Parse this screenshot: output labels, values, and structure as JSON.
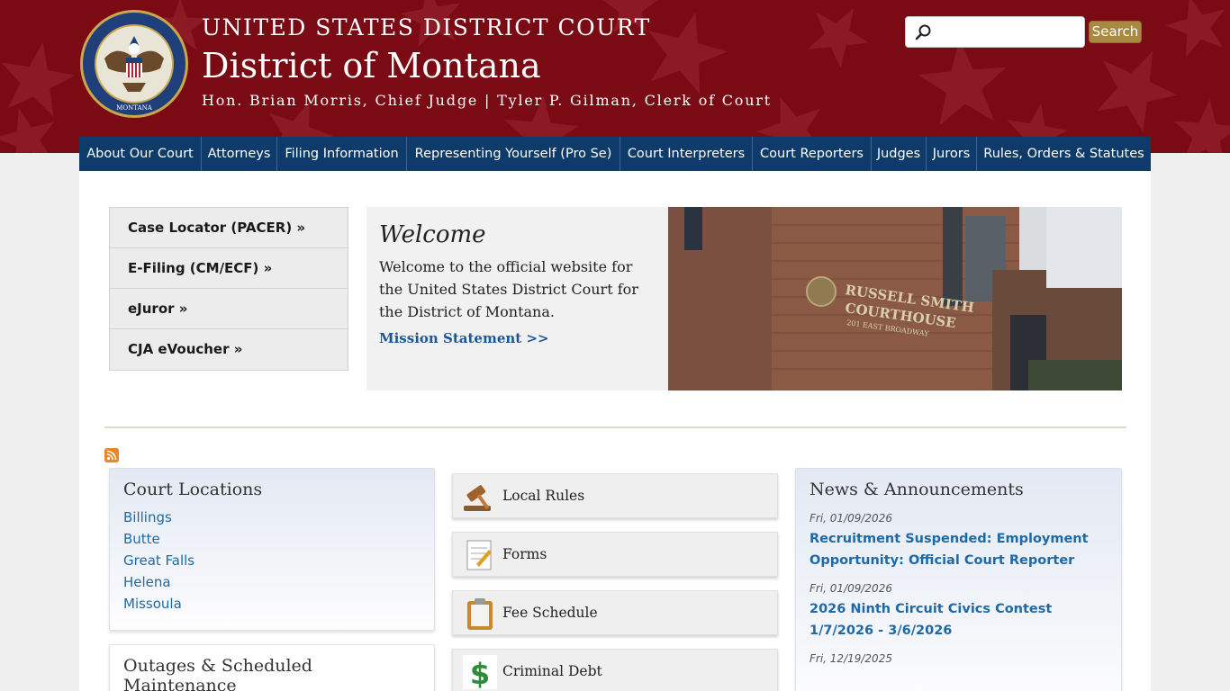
{
  "header": {
    "court_top": "UNITED STATES DISTRICT COURT",
    "court_name": "District of Montana",
    "judge_line": "Hon. Brian Morris, Chief Judge | Tyler P. Gilman, Clerk of Court",
    "seal_text_top": "UNITED STATES DISTRICT COURT",
    "seal_text_bottom": "MONTANA"
  },
  "search": {
    "placeholder": "",
    "button_label": "Search"
  },
  "nav": {
    "items": [
      {
        "label": "About Our Court"
      },
      {
        "label": "Attorneys"
      },
      {
        "label": "Filing Information"
      },
      {
        "label": "Representing Yourself (Pro Se)"
      },
      {
        "label": "Court Interpreters"
      },
      {
        "label": "Court Reporters"
      },
      {
        "label": "Judges"
      },
      {
        "label": "Jurors"
      },
      {
        "label": "Rules, Orders & Statutes"
      }
    ]
  },
  "quick_links": [
    {
      "label": "Case Locator (PACER) »"
    },
    {
      "label": "E-Filing (CM/ECF) »"
    },
    {
      "label": "eJuror »"
    },
    {
      "label": "CJA eVoucher »"
    }
  ],
  "welcome": {
    "title": "Welcome",
    "text": "Welcome to the official website for the United States District Court for the District of Montana.",
    "link": "Mission Statement >>"
  },
  "building": {
    "sign_line1": "RUSSELL SMITH",
    "sign_line2": "COURTHOUSE",
    "sign_line3": "201 EAST BROADWAY"
  },
  "locations": {
    "title": "Court Locations",
    "items": [
      "Billings",
      "Butte",
      "Great Falls",
      "Helena",
      "Missoula"
    ]
  },
  "outages": {
    "title": "Outages & Scheduled Maintenance"
  },
  "tiles": [
    {
      "label": "Local Rules",
      "icon": "gavel-icon"
    },
    {
      "label": "Forms",
      "icon": "form-icon"
    },
    {
      "label": "Fee Schedule",
      "icon": "clipboard-icon"
    },
    {
      "label": "Criminal Debt",
      "icon": "dollar-icon"
    }
  ],
  "news": {
    "title": "News & Announcements",
    "items": [
      {
        "date": "Fri, 01/09/2026",
        "title": "Recruitment Suspended: Employment Opportunity: Official Court Reporter"
      },
      {
        "date": "Fri, 01/09/2026",
        "title": "2026 Ninth Circuit Civics Contest 1/7/2026 - 3/6/2026"
      },
      {
        "date": "Fri, 12/19/2025",
        "title": ""
      }
    ]
  },
  "colors": {
    "header_red": "#7a0a14",
    "nav_blue": "#0f3b6b",
    "link_blue": "#1e6aa8",
    "search_gold": "#a8893f"
  }
}
